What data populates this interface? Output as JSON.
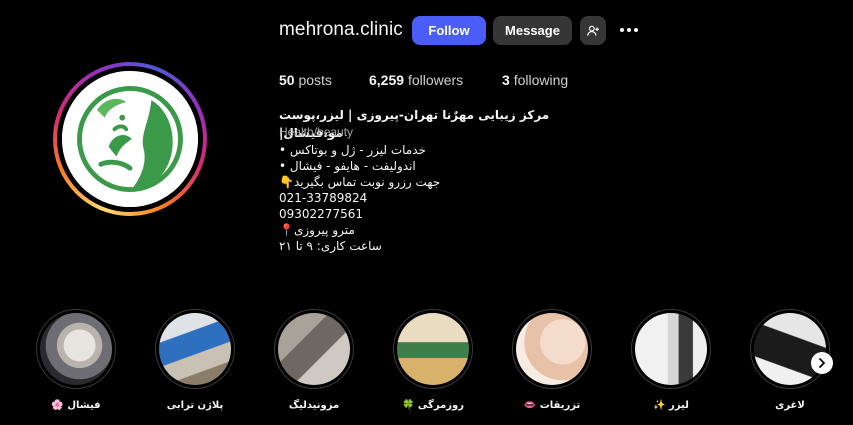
{
  "profile": {
    "username": "mehrona.clinic",
    "follow_label": "Follow",
    "message_label": "Message",
    "add_user_icon": "add-user-icon",
    "more_icon": "more-options-icon"
  },
  "stats": {
    "posts_count": "50",
    "posts_label": "posts",
    "followers_count": "6,259",
    "followers_label": "followers",
    "following_count": "3",
    "following_label": "following"
  },
  "bio": {
    "name": "مرکز زیبایی مهرٌنا تهران-پیروزی | لیزر،پوست مو،فیشال|",
    "category": "Health/beauty",
    "lines": [
      "خدمات لیزر - ژل و بوتاکس •",
      "اندولیفت - هایفو - فیشال •",
      "جهت رزرو نوبت تماس بگیرید👇",
      "021-33789824",
      "09302277561",
      "مترو پیروزی📍",
      "ساعت کاری: ۹ تا ۲۱"
    ]
  },
  "highlights": [
    {
      "label": "فیشال 🌸"
    },
    {
      "label": "پلاژن ترابی"
    },
    {
      "label": "مزونیدلیگ"
    },
    {
      "label": "روزمرگی 🍀"
    },
    {
      "label": "تزریقات 👄"
    },
    {
      "label": "لیزر ✨"
    },
    {
      "label": "لاغری"
    }
  ],
  "colors": {
    "background": "#000000",
    "follow_button": "#4a5df9",
    "secondary_button": "#363636",
    "logo_green": "#3a9a4a"
  }
}
